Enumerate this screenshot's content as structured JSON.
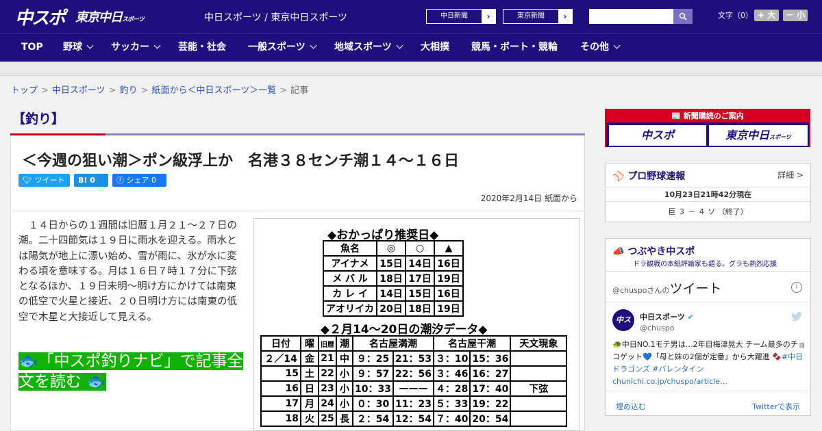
{
  "header": {
    "logo_chuspo": "中スポ",
    "logo_tokyo": "東京中日",
    "logo_tokyo_small": "スポーツ",
    "site_name": "中日スポーツ / 東京中日スポーツ",
    "newspaper1": "中日新聞",
    "newspaper2": "東京新聞",
    "font_label": "文字（0）",
    "font_larger": "+ 大",
    "font_smaller": "－ 小",
    "colors": {
      "brand": "#1e0f7d",
      "accent": "#d60020"
    }
  },
  "nav": {
    "items": [
      {
        "label": "TOP",
        "has_dropdown": false
      },
      {
        "label": "野球",
        "has_dropdown": true
      },
      {
        "label": "サッカー",
        "has_dropdown": true
      },
      {
        "label": "芸能・社会",
        "has_dropdown": false
      },
      {
        "label": "一般スポーツ",
        "has_dropdown": true
      },
      {
        "label": "地域スポーツ",
        "has_dropdown": true
      },
      {
        "label": "大相撲",
        "has_dropdown": false
      },
      {
        "label": "競馬・ボート・競輪",
        "has_dropdown": false
      },
      {
        "label": "その他",
        "has_dropdown": true
      }
    ]
  },
  "breadcrumb": {
    "items": [
      "トップ",
      "中日スポーツ",
      "釣り",
      "紙面から＜中日スポーツ＞一覧"
    ],
    "current": "記事",
    "separator": ">"
  },
  "category": "【釣り】",
  "article": {
    "title": "＜今週の狙い潮＞ポン級浮上か　名港３８センチ潮１４～１６日",
    "share": {
      "twitter": "ツイート",
      "hatena": "0",
      "facebook": "シェア 0"
    },
    "date": "2020年2月14日 紙面から",
    "body": "　１４日からの１週間は旧暦１月２１～２７日の潮。二十四節気は１９日に雨水を迎える。雨水とは陽気が地上に漂い始め、雪が雨に、氷が水に変わる頃を意味する。月は１６日７時１７分に下弦となるほか、１９日未明～明け方にかけては南東の低空で火星と接近、２０日明け方には南東の低空で木星と大接近して見える。",
    "navi_link": "🐟「中スポ釣りナビ」で記事全文を読む 🐟"
  },
  "image": {
    "title1": "◆おかっぱり推奨日◆",
    "table1": {
      "headers": [
        "魚名",
        "◎",
        "○",
        "▲"
      ],
      "rows": [
        [
          "アイナメ",
          "15日",
          "14日",
          "16日"
        ],
        [
          "メ バ ル",
          "18日",
          "17日",
          "19日"
        ],
        [
          "カ レ イ",
          "14日",
          "15日",
          "16日"
        ],
        [
          "アオリイカ",
          "20日",
          "18日",
          "19日"
        ]
      ]
    },
    "title2": "◆２月14～20日の潮汐データ◆",
    "table2": {
      "headers": [
        "日付",
        "曜",
        "旧暦",
        "潮",
        "名古屋満潮",
        "名古屋干潮",
        "天文現象"
      ],
      "rows": [
        [
          "２／14",
          "金",
          "21",
          "中",
          "９：25",
          "21：53",
          "３：10",
          "15：36",
          ""
        ],
        [
          "15",
          "土",
          "22",
          "小",
          "９：57",
          "22：56",
          "３：46",
          "16：27",
          ""
        ],
        [
          "16",
          "日",
          "23",
          "小",
          "10：33",
          "———",
          "４：28",
          "17：40",
          "下弦"
        ],
        [
          "17",
          "月",
          "24",
          "小",
          "０：30",
          "11：23",
          "５：33",
          "19：22",
          ""
        ],
        [
          "18",
          "火",
          "25",
          "長",
          "２：54",
          "12：54",
          "７：40",
          "20：54",
          ""
        ]
      ]
    }
  },
  "sidebar": {
    "subscribe_title": "新聞購読のご案内",
    "subscribe_logo1": "中スポ",
    "subscribe_logo2": "東京中日",
    "subscribe_logo2_small": "スポーツ",
    "baseball_title": "プロ野球速報",
    "baseball_detail": "詳細 >",
    "baseball_time": "10月23日21時42分現在",
    "baseball_score": "巨 ３ － ４ ソ （終了）",
    "tweet_title": "つぶやき中スポ",
    "tweet_subtitle": "ドラ観戦の本紙評論家も語る。グラも熱烈応援",
    "tweet_handle_label": "@chuspoさんの",
    "tweet_label": "ツイート",
    "tweet_name": "中日スポーツ",
    "tweet_handle": "@chuspo",
    "tweet_text": "🐢中日NO.1モテ男は…2年目梅津晃大 チーム最多のチョコゲット💙「母と妹の2個が定番」から大躍進 🍫",
    "tweet_hashtags": "#中日ドラゴンズ #バレンタイン",
    "tweet_link": "chunichi.co.jp/chuspo/article…",
    "embed": "埋め込む",
    "view_on_twitter": "Twitterで表示"
  }
}
